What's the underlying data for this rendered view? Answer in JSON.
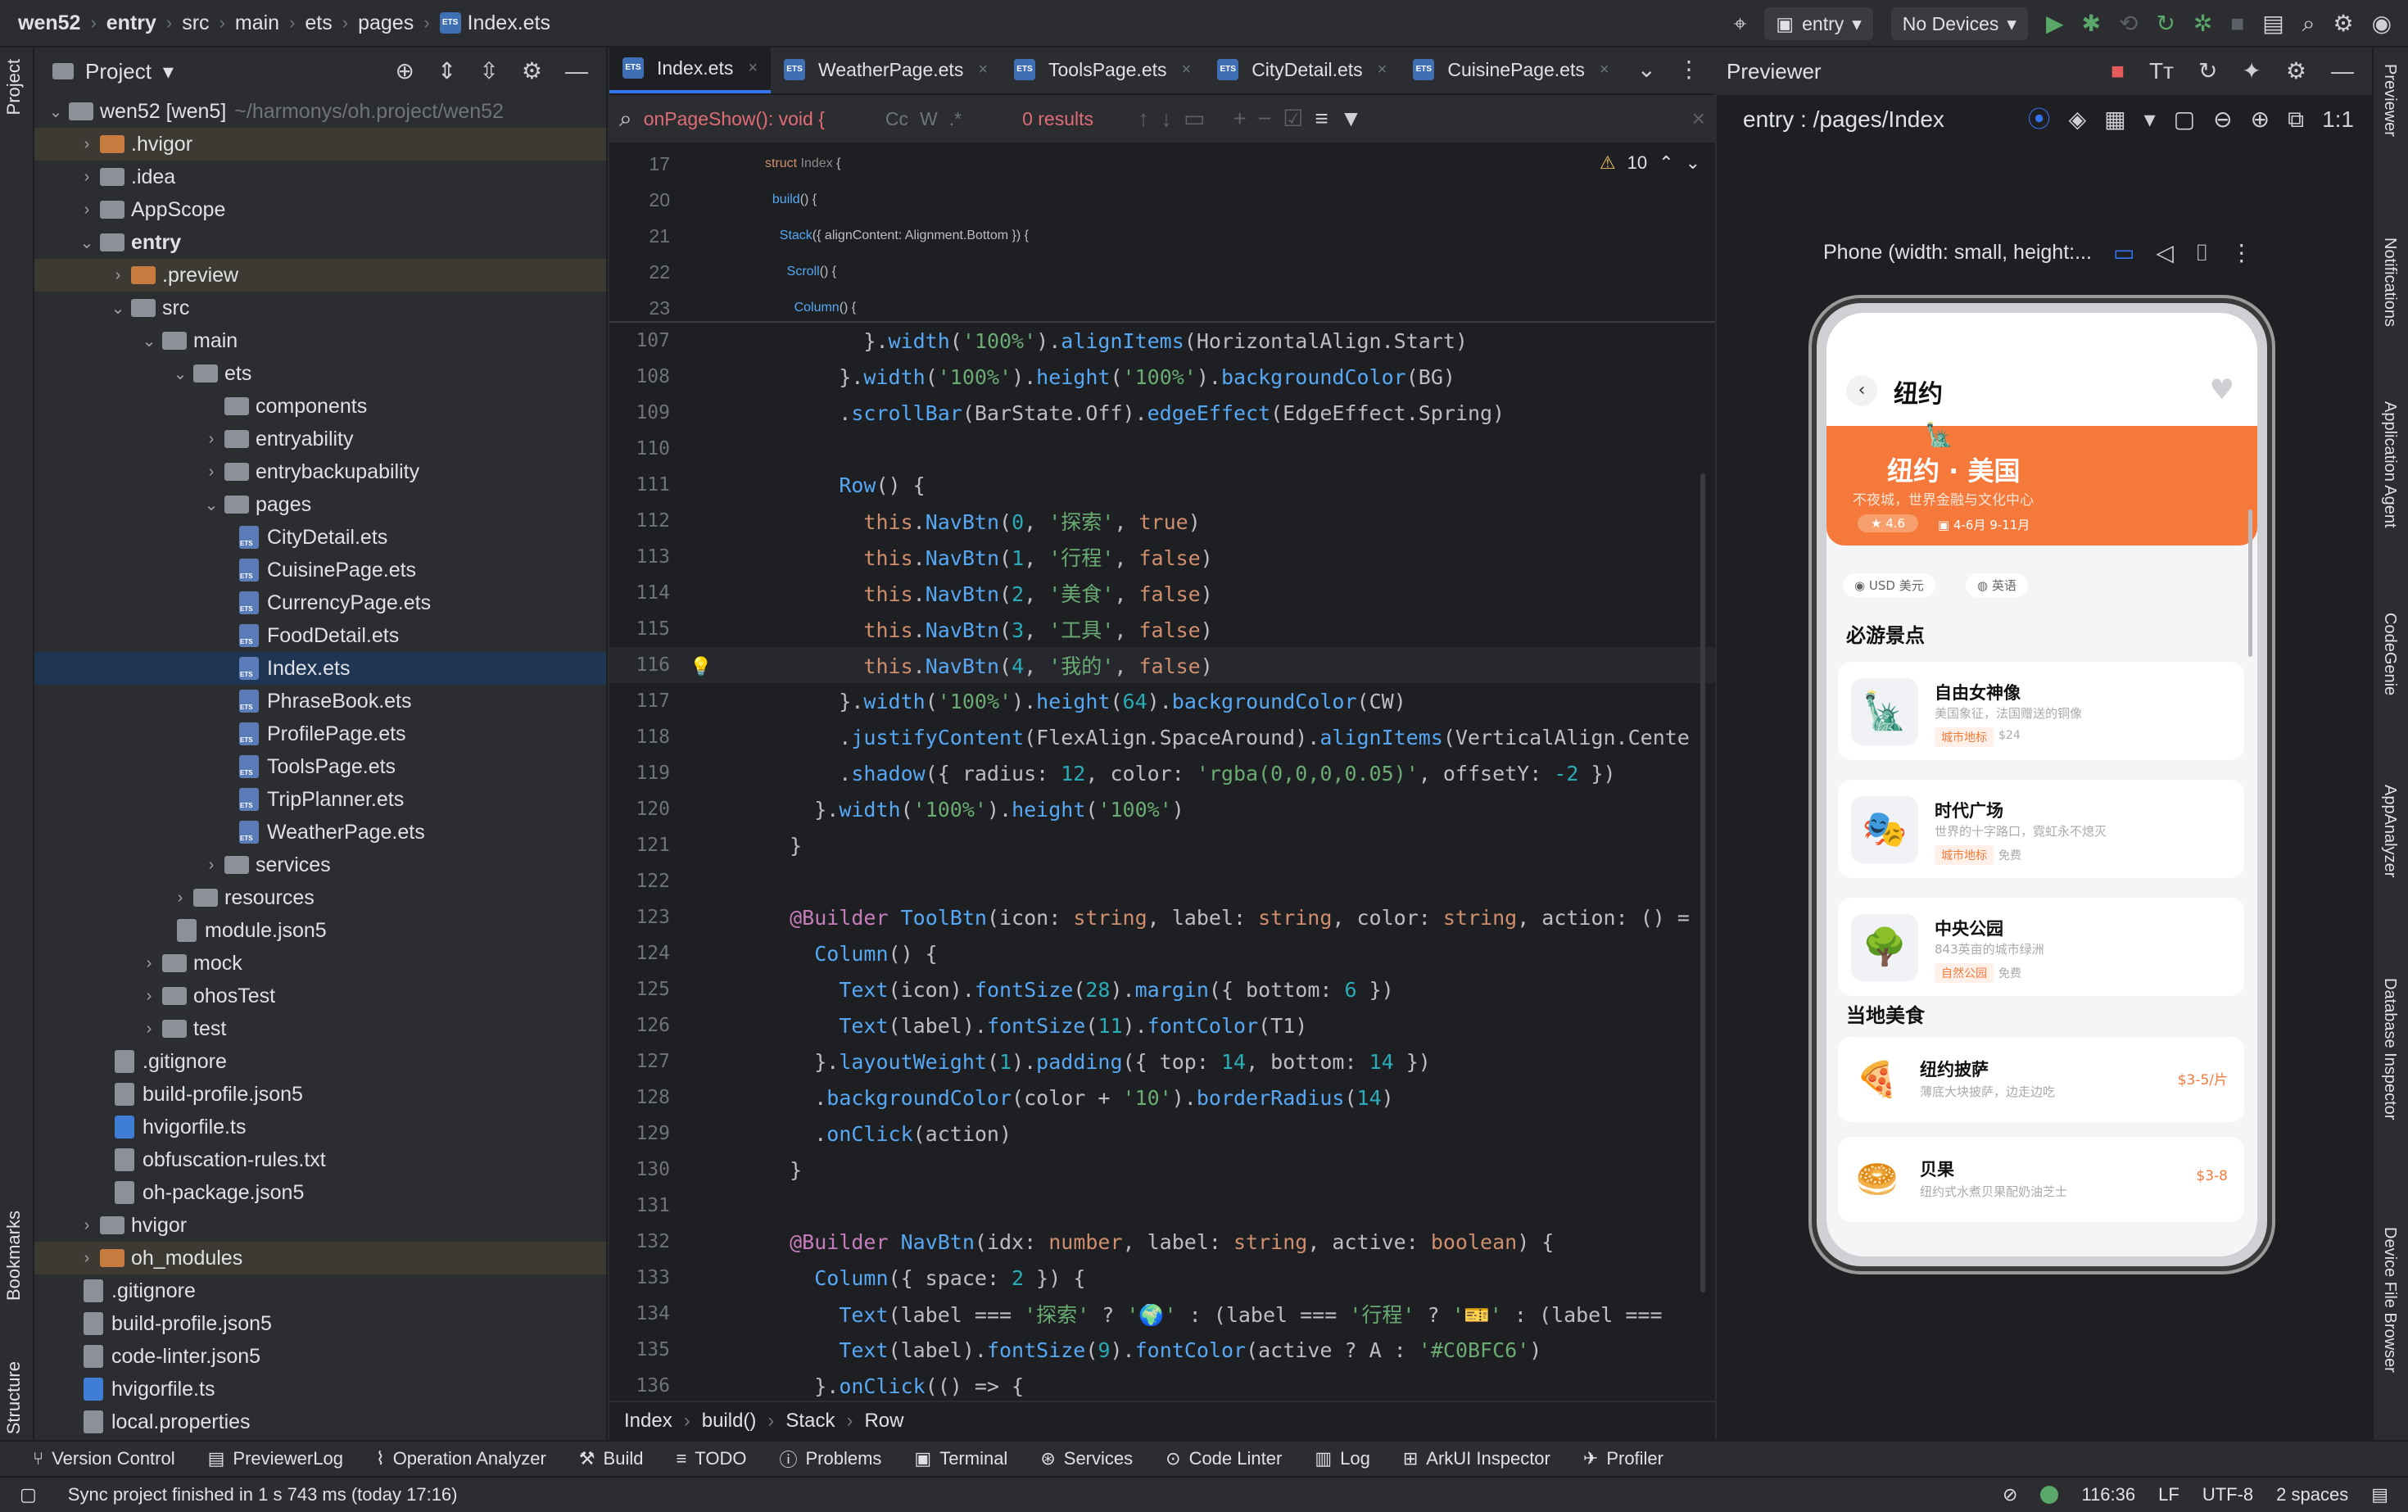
{
  "titlebar": {
    "crumbs": [
      "wen52",
      "entry",
      "src",
      "main",
      "ets",
      "pages",
      "Index.ets"
    ],
    "run_config": "entry",
    "device": "No Devices"
  },
  "left_strip": {
    "project": "Project",
    "bookmarks": "Bookmarks",
    "structure": "Structure"
  },
  "project": {
    "title": "Project",
    "root": "wen52 [wen5]",
    "root_path": "~/harmonys/oh.project/wen52",
    "items": [
      {
        "label": ".hvigor",
        "depth": 1,
        "kind": "folder-orange",
        "chev": "right",
        "hl": "ex"
      },
      {
        "label": ".idea",
        "depth": 1,
        "kind": "folder",
        "chev": "right"
      },
      {
        "label": "AppScope",
        "depth": 1,
        "kind": "folder",
        "chev": "right"
      },
      {
        "label": "entry",
        "depth": 1,
        "kind": "folder",
        "chev": "down",
        "bold": true
      },
      {
        "label": ".preview",
        "depth": 2,
        "kind": "folder-orange",
        "chev": "right",
        "hl": "ex"
      },
      {
        "label": "src",
        "depth": 2,
        "kind": "folder",
        "chev": "down"
      },
      {
        "label": "main",
        "depth": 3,
        "kind": "folder",
        "chev": "down"
      },
      {
        "label": "ets",
        "depth": 4,
        "kind": "folder",
        "chev": "down"
      },
      {
        "label": "components",
        "depth": 5,
        "kind": "folder",
        "chev": "none"
      },
      {
        "label": "entryability",
        "depth": 5,
        "kind": "folder",
        "chev": "right"
      },
      {
        "label": "entrybackupability",
        "depth": 5,
        "kind": "folder",
        "chev": "right"
      },
      {
        "label": "pages",
        "depth": 5,
        "kind": "folder",
        "chev": "down"
      },
      {
        "label": "CityDetail.ets",
        "depth": 6,
        "kind": "ets"
      },
      {
        "label": "CuisinePage.ets",
        "depth": 6,
        "kind": "ets"
      },
      {
        "label": "CurrencyPage.ets",
        "depth": 6,
        "kind": "ets"
      },
      {
        "label": "FoodDetail.ets",
        "depth": 6,
        "kind": "ets"
      },
      {
        "label": "Index.ets",
        "depth": 6,
        "kind": "ets",
        "hl": "sel"
      },
      {
        "label": "PhraseBook.ets",
        "depth": 6,
        "kind": "ets"
      },
      {
        "label": "ProfilePage.ets",
        "depth": 6,
        "kind": "ets"
      },
      {
        "label": "ToolsPage.ets",
        "depth": 6,
        "kind": "ets"
      },
      {
        "label": "TripPlanner.ets",
        "depth": 6,
        "kind": "ets"
      },
      {
        "label": "WeatherPage.ets",
        "depth": 6,
        "kind": "ets"
      },
      {
        "label": "services",
        "depth": 5,
        "kind": "folder",
        "chev": "right"
      },
      {
        "label": "resources",
        "depth": 4,
        "kind": "folder",
        "chev": "right"
      },
      {
        "label": "module.json5",
        "depth": 4,
        "kind": "file"
      },
      {
        "label": "mock",
        "depth": 3,
        "kind": "folder",
        "chev": "right"
      },
      {
        "label": "ohosTest",
        "depth": 3,
        "kind": "folder",
        "chev": "right"
      },
      {
        "label": "test",
        "depth": 3,
        "kind": "folder",
        "chev": "right"
      },
      {
        "label": ".gitignore",
        "depth": 2,
        "kind": "file"
      },
      {
        "label": "build-profile.json5",
        "depth": 2,
        "kind": "file"
      },
      {
        "label": "hvigorfile.ts",
        "depth": 2,
        "kind": "ts"
      },
      {
        "label": "obfuscation-rules.txt",
        "depth": 2,
        "kind": "file"
      },
      {
        "label": "oh-package.json5",
        "depth": 2,
        "kind": "file"
      },
      {
        "label": "hvigor",
        "depth": 1,
        "kind": "folder",
        "chev": "right"
      },
      {
        "label": "oh_modules",
        "depth": 1,
        "kind": "folder-orange",
        "chev": "right",
        "hl": "ex"
      },
      {
        "label": ".gitignore",
        "depth": 1,
        "kind": "file"
      },
      {
        "label": "build-profile.json5",
        "depth": 1,
        "kind": "file"
      },
      {
        "label": "code-linter.json5",
        "depth": 1,
        "kind": "file"
      },
      {
        "label": "hvigorfile.ts",
        "depth": 1,
        "kind": "ts"
      },
      {
        "label": "local.properties",
        "depth": 1,
        "kind": "file"
      }
    ]
  },
  "editor": {
    "tabs": [
      {
        "label": "Index.ets",
        "active": true
      },
      {
        "label": "WeatherPage.ets"
      },
      {
        "label": "ToolsPage.ets"
      },
      {
        "label": "CityDetail.ets"
      },
      {
        "label": "CuisinePage.ets"
      }
    ],
    "find": {
      "query": "onPageShow(): void {",
      "cc": "Cc",
      "w": "W",
      "results": "0 results"
    },
    "warnings": "10",
    "sticky": [
      {
        "n": "17",
        "html": "<span class='k'>struct</span> <span class='cls'>Index</span> {"
      },
      {
        "n": "20",
        "html": "  <span class='fn'>build</span>() {"
      },
      {
        "n": "21",
        "html": "    <span class='fn'>Stack</span>({ alignContent: Alignment.Bottom }) {"
      },
      {
        "n": "22",
        "html": "      <span class='fn'>Scroll</span>() {"
      },
      {
        "n": "23",
        "html": "        <span class='fn'>Column</span>() {"
      }
    ],
    "lines": [
      {
        "n": "107",
        "html": "        }.<span class='fn'>width</span>(<span class='s'>'100%'</span>).<span class='fn'>alignItems</span>(HorizontalAlign.Start)"
      },
      {
        "n": "108",
        "html": "      }.<span class='fn'>width</span>(<span class='s'>'100%'</span>).<span class='fn'>height</span>(<span class='s'>'100%'</span>).<span class='fn'>backgroundColor</span>(BG)"
      },
      {
        "n": "109",
        "html": "      .<span class='fn'>scrollBar</span>(BarState.Off).<span class='fn'>edgeEffect</span>(EdgeEffect.Spring)"
      },
      {
        "n": "110",
        "html": ""
      },
      {
        "n": "111",
        "html": "      <span class='fn'>Row</span>() {"
      },
      {
        "n": "112",
        "html": "        <span class='k'>this</span>.<span class='fn'>NavBtn</span>(<span class='num'>0</span>, <span class='s'>'探索'</span>, <span class='k'>true</span>)"
      },
      {
        "n": "113",
        "html": "        <span class='k'>this</span>.<span class='fn'>NavBtn</span>(<span class='num'>1</span>, <span class='s'>'行程'</span>, <span class='k'>false</span>)"
      },
      {
        "n": "114",
        "html": "        <span class='k'>this</span>.<span class='fn'>NavBtn</span>(<span class='num'>2</span>, <span class='s'>'美食'</span>, <span class='k'>false</span>)"
      },
      {
        "n": "115",
        "html": "        <span class='k'>this</span>.<span class='fn'>NavBtn</span>(<span class='num'>3</span>, <span class='s'>'工具'</span>, <span class='k'>false</span>)"
      },
      {
        "n": "116",
        "html": "        <span class='k'>this</span>.<span class='fn'>NavBtn</span>(<span class='num'>4</span>, <span class='s'>'我的'</span>, <span class='k'>false</span>)",
        "current": true
      },
      {
        "n": "117",
        "html": "      }.<span class='fn'>width</span>(<span class='s'>'100%'</span>).<span class='fn'>height</span>(<span class='num'>64</span>).<span class='fn'>backgroundColor</span>(CW)"
      },
      {
        "n": "118",
        "html": "      .<span class='fn'>justifyContent</span>(FlexAlign.SpaceAround).<span class='fn'>alignItems</span>(VerticalAlign.Cente"
      },
      {
        "n": "119",
        "html": "      .<span class='fn'>shadow</span>({ radius: <span class='num'>12</span>, color: <span class='s'>'rgba(0,0,0,0.05)'</span>, offsetY: <span class='num'>-2</span> })"
      },
      {
        "n": "120",
        "html": "    }.<span class='fn'>width</span>(<span class='s'>'100%'</span>).<span class='fn'>height</span>(<span class='s'>'100%'</span>)"
      },
      {
        "n": "121",
        "html": "  }"
      },
      {
        "n": "122",
        "html": ""
      },
      {
        "n": "123",
        "html": "  <span class='t'>@Builder</span> <span class='fn'>ToolBtn</span>(icon: <span class='k'>string</span>, label: <span class='k'>string</span>, color: <span class='k'>string</span>, action: () ="
      },
      {
        "n": "124",
        "html": "    <span class='fn'>Column</span>() {"
      },
      {
        "n": "125",
        "html": "      <span class='fn'>Text</span>(icon).<span class='fn'>fontSize</span>(<span class='num'>28</span>).<span class='fn'>margin</span>({ bottom: <span class='num'>6</span> })"
      },
      {
        "n": "126",
        "html": "      <span class='fn'>Text</span>(label).<span class='fn'>fontSize</span>(<span class='num'>11</span>).<span class='fn'>fontColor</span>(T1)"
      },
      {
        "n": "127",
        "html": "    }.<span class='fn'>layoutWeight</span>(<span class='num'>1</span>).<span class='fn'>padding</span>({ top: <span class='num'>14</span>, bottom: <span class='num'>14</span> })"
      },
      {
        "n": "128",
        "html": "    .<span class='fn'>backgroundColor</span>(color + <span class='s'>'10'</span>).<span class='fn'>borderRadius</span>(<span class='num'>14</span>)"
      },
      {
        "n": "129",
        "html": "    .<span class='fn'>onClick</span>(action)"
      },
      {
        "n": "130",
        "html": "  }"
      },
      {
        "n": "131",
        "html": ""
      },
      {
        "n": "132",
        "html": "  <span class='t'>@Builder</span> <span class='fn'>NavBtn</span>(idx: <span class='k'>number</span>, label: <span class='k'>string</span>, active: <span class='k'>boolean</span>) {"
      },
      {
        "n": "133",
        "html": "    <span class='fn'>Column</span>({ space: <span class='num'>2</span> }) {"
      },
      {
        "n": "134",
        "html": "      <span class='fn'>Text</span>(label === <span class='s'>'探索'</span> ? <span class='s'>'🌍'</span> : (label === <span class='s'>'行程'</span> ? <span class='s'>'🎫'</span> : (label ==="
      },
      {
        "n": "135",
        "html": "      <span class='fn'>Text</span>(label).<span class='fn'>fontSize</span>(<span class='num'>9</span>).<span class='fn'>fontColor</span>(active ? A : <span class='s'>'#C0BFC6'</span>)"
      },
      {
        "n": "136",
        "html": "    }.<span class='fn'>onClick</span>(() => {"
      }
    ],
    "breadcrumb": [
      "Index",
      "build()",
      "Stack",
      "Row"
    ]
  },
  "previewer": {
    "title": "Previewer",
    "route": "entry : /pages/Index",
    "device_label": "Phone (width: small, height:..."
  },
  "phone": {
    "header_title": "纽约",
    "banner_title": "纽约 · 美国",
    "banner_sub": "不夜城，世界金融与文化中心",
    "rating": "4.6",
    "season": "4-6月 9-11月",
    "chips": [
      "USD 美元",
      "英语"
    ],
    "section1": "必游景点",
    "spots": [
      {
        "icon": "🗽",
        "title": "自由女神像",
        "sub": "美国象征，法国赠送的铜像",
        "tag": "城市地标",
        "price": "$24"
      },
      {
        "icon": "🎭",
        "title": "时代广场",
        "sub": "世界的十字路口，霓虹永不熄灭",
        "tag": "城市地标",
        "price": "免费"
      },
      {
        "icon": "🌳",
        "title": "中央公园",
        "sub": "843英亩的城市绿洲",
        "tag": "自然公园",
        "price": "免费"
      }
    ],
    "section2": "当地美食",
    "foods": [
      {
        "icon": "🍕",
        "title": "纽约披萨",
        "sub": "薄底大块披萨，边走边吃",
        "price": "$3-5/片"
      },
      {
        "icon": "🥯",
        "title": "贝果",
        "sub": "纽约式水煮贝果配奶油芝士",
        "price": "$3-8"
      }
    ]
  },
  "right_strip": [
    "Previewer",
    "Notifications",
    "Application Agent",
    "CodeGenie",
    "AppAnalyzer",
    "Database Inspector",
    "Device File Browser"
  ],
  "bottom_tools": [
    "Version Control",
    "PreviewerLog",
    "Operation Analyzer",
    "Build",
    "TODO",
    "Problems",
    "Terminal",
    "Services",
    "Code Linter",
    "Log",
    "ArkUI Inspector",
    "Profiler"
  ],
  "status": {
    "message": "Sync project finished in 1 s 743 ms (today 17:16)",
    "position": "116:36",
    "line_sep": "LF",
    "encoding": "UTF-8",
    "indent": "2 spaces"
  },
  "colors": {
    "accent": "#3574f0",
    "orange": "#f5793b",
    "selection": "#1f3554"
  }
}
